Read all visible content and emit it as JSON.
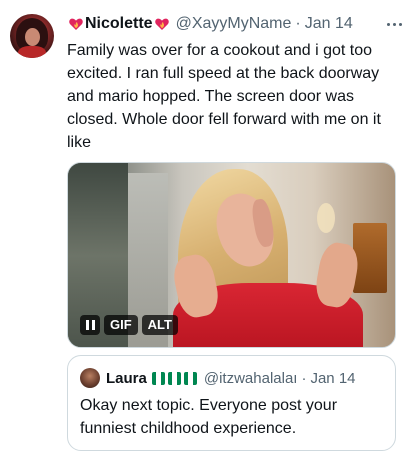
{
  "tweet": {
    "author_name": "Nicolette",
    "handle": "@XayyMyName",
    "separator": "·",
    "date": "Jan 14",
    "text": "Family was over for a cookout and i got too excited. I ran full speed at the back doorway and mario hopped. The screen door was closed. Whole door fell forward with me on it like",
    "name_emoji": "heart-on-fire-icon",
    "more_icon": "more-options-icon"
  },
  "media": {
    "type": "gif",
    "gif_label": "GIF",
    "alt_label": "ALT",
    "pause_icon": "pause-icon"
  },
  "quoted_tweet": {
    "author_name": "Laura",
    "handle": "@itzwahalalaı",
    "separator": "·",
    "date": "Jan 14",
    "text": "Okay next topic. Everyone post your funniest childhood experience.",
    "flag_emoji": "nigeria-flag-icon",
    "flag_count": 3
  },
  "colors": {
    "text_primary": "#0f1419",
    "text_secondary": "#536471",
    "border": "#cfd9de",
    "flag_green": "#008751",
    "heart_red": "#e0245e"
  }
}
